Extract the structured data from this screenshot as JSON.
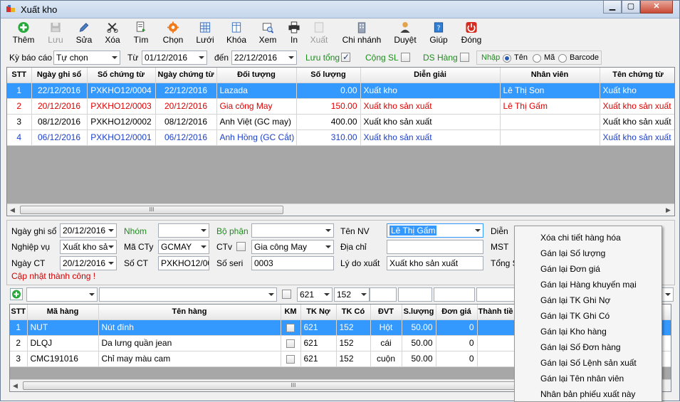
{
  "window": {
    "title": "Xuất kho"
  },
  "toolbar": {
    "them": "Thêm",
    "luu": "Lưu",
    "sua": "Sửa",
    "xoa": "Xóa",
    "tim": "Tìm",
    "chon": "Chọn",
    "luoi": "Lưới",
    "khoa": "Khóa",
    "xem": "Xem",
    "in": "In",
    "xuat": "Xuất",
    "chinhanh": "Chi nhánh",
    "duyet": "Duyệt",
    "giup": "Giúp",
    "dong": "Đóng"
  },
  "filter": {
    "kybaocao_label": "Kỳ báo cáo",
    "kybaocao_value": "Tự chọn",
    "tu_label": "Từ",
    "tu_value": "01/12/2016",
    "den_label": "đến",
    "den_value": "22/12/2016",
    "luutong_label": "Lưu tổng",
    "congsl_label": "Cộng SL",
    "dshang_label": "DS Hàng",
    "nhap_label": "Nhập",
    "ten_label": "Tên",
    "ma_label": "Mã",
    "barcode_label": "Barcode"
  },
  "grid1": {
    "headers": [
      "STT",
      "Ngày ghi sổ",
      "Số chứng từ",
      "Ngày chứng từ",
      "Đối tượng",
      "Số lượng",
      "Diễn giải",
      "Nhân viên",
      "Tên chứng từ"
    ],
    "rows": [
      {
        "stt": "1",
        "ngayghiso": "22/12/2016",
        "sochungtu": "PXKHO12/0004",
        "ngaychungtu": "22/12/2016",
        "doituong": "Lazada",
        "soluong": "0.00",
        "diengiai": "Xuất kho",
        "nhanvien": "Lê Thị Son",
        "tenchungtu": "Xuất kho"
      },
      {
        "stt": "2",
        "ngayghiso": "20/12/2016",
        "sochungtu": "PXKHO12/0003",
        "ngaychungtu": "20/12/2016",
        "doituong": "Gia công May",
        "soluong": "150.00",
        "diengiai": "Xuất kho sản xuất",
        "nhanvien": "Lê Thị Gấm",
        "tenchungtu": "Xuất kho sản xuất"
      },
      {
        "stt": "3",
        "ngayghiso": "08/12/2016",
        "sochungtu": "PXKHO12/0002",
        "ngaychungtu": "08/12/2016",
        "doituong": "Anh Việt (GC may)",
        "soluong": "400.00",
        "diengiai": "Xuất kho sản xuất",
        "nhanvien": "",
        "tenchungtu": "Xuất kho sản xuất"
      },
      {
        "stt": "4",
        "ngayghiso": "06/12/2016",
        "sochungtu": "PXKHO12/0001",
        "ngaychungtu": "06/12/2016",
        "doituong": "Anh Hồng (GC Cắt)",
        "soluong": "310.00",
        "diengiai": "Xuất kho sản xuất",
        "nhanvien": "",
        "tenchungtu": "Xuất kho sản xuất"
      }
    ],
    "scroll_glyph": "III"
  },
  "form": {
    "ngayghiso_label": "Ngày ghi sổ",
    "ngayghiso_value": "20/12/2016",
    "nhom_label": "Nhóm",
    "nhom_value": "",
    "bophan_label": "Bộ phận",
    "bophan_value": "",
    "tennv_label": "Tên NV",
    "tennv_value": "Lê Thị Gấm",
    "dien_label": "Diễn",
    "nghiepvu_label": "Nghiệp vụ",
    "nghiepvu_value": "Xuất kho sả",
    "macty_label": "Mã CTy",
    "macty_value": "GCMAY",
    "ctv_label": "CTv",
    "ctv_value": "Gia công May",
    "diachi_label": "Địa chỉ",
    "diachi_value": "",
    "mst_label": "MST",
    "ngayct_label": "Ngày CT",
    "ngayct_value": "20/12/2016",
    "soct_label": "Số CT",
    "soct_value": "PXKHO12/000",
    "soseri_label": "Số seri",
    "soseri_value": "0003",
    "lydoxuat_label": "Lý do xuất",
    "lydoxuat_value": "Xuất kho sản xuất",
    "tongs_label": "Tổng S",
    "status": "Cập nhật thành công !"
  },
  "entry": {
    "tkno": "621",
    "tkco": "152"
  },
  "grid2": {
    "headers": [
      "STT",
      "Mã hàng",
      "Tên hàng",
      "KM",
      "TK Nợ",
      "TK Có",
      "ĐVT",
      "S.lượng",
      "Đơn giá",
      "Thành tiề"
    ],
    "rows": [
      {
        "stt": "1",
        "mahang": "NUT",
        "tenhang": "Nút đính",
        "tkno": "621",
        "tkco": "152",
        "dvt": "Hột",
        "soluong": "50.00",
        "dongia": "0"
      },
      {
        "stt": "2",
        "mahang": "DLQJ",
        "tenhang": "Da lưng quần jean",
        "tkno": "621",
        "tkco": "152",
        "dvt": "cái",
        "soluong": "50.00",
        "dongia": "0"
      },
      {
        "stt": "3",
        "mahang": "CMC191016",
        "tenhang": "Chỉ may màu cam",
        "tkno": "621",
        "tkco": "152",
        "dvt": "cuộn",
        "soluong": "50.00",
        "dongia": "0"
      }
    ],
    "scroll_glyph": "III"
  },
  "context_menu": {
    "items": [
      "Xóa chi tiết hàng hóa",
      "Gán lại Số lượng",
      "Gán lại Đơn giá",
      "Gán lại Hàng khuyến mại",
      "Gán lại TK Ghi Nợ",
      "Gán lại TK Ghi Có",
      "Gán lại Kho hàng",
      "Gán lại Số Đơn hàng",
      "Gán lại Số Lệnh sản xuất",
      "Gán lại Tên nhân viên",
      "Nhân bản phiếu xuất này"
    ]
  },
  "colors": {
    "selection": "#3399ff",
    "red_row": "#e00000",
    "blue_row": "#1a3fcc",
    "green_label": "#1e8c1e"
  }
}
